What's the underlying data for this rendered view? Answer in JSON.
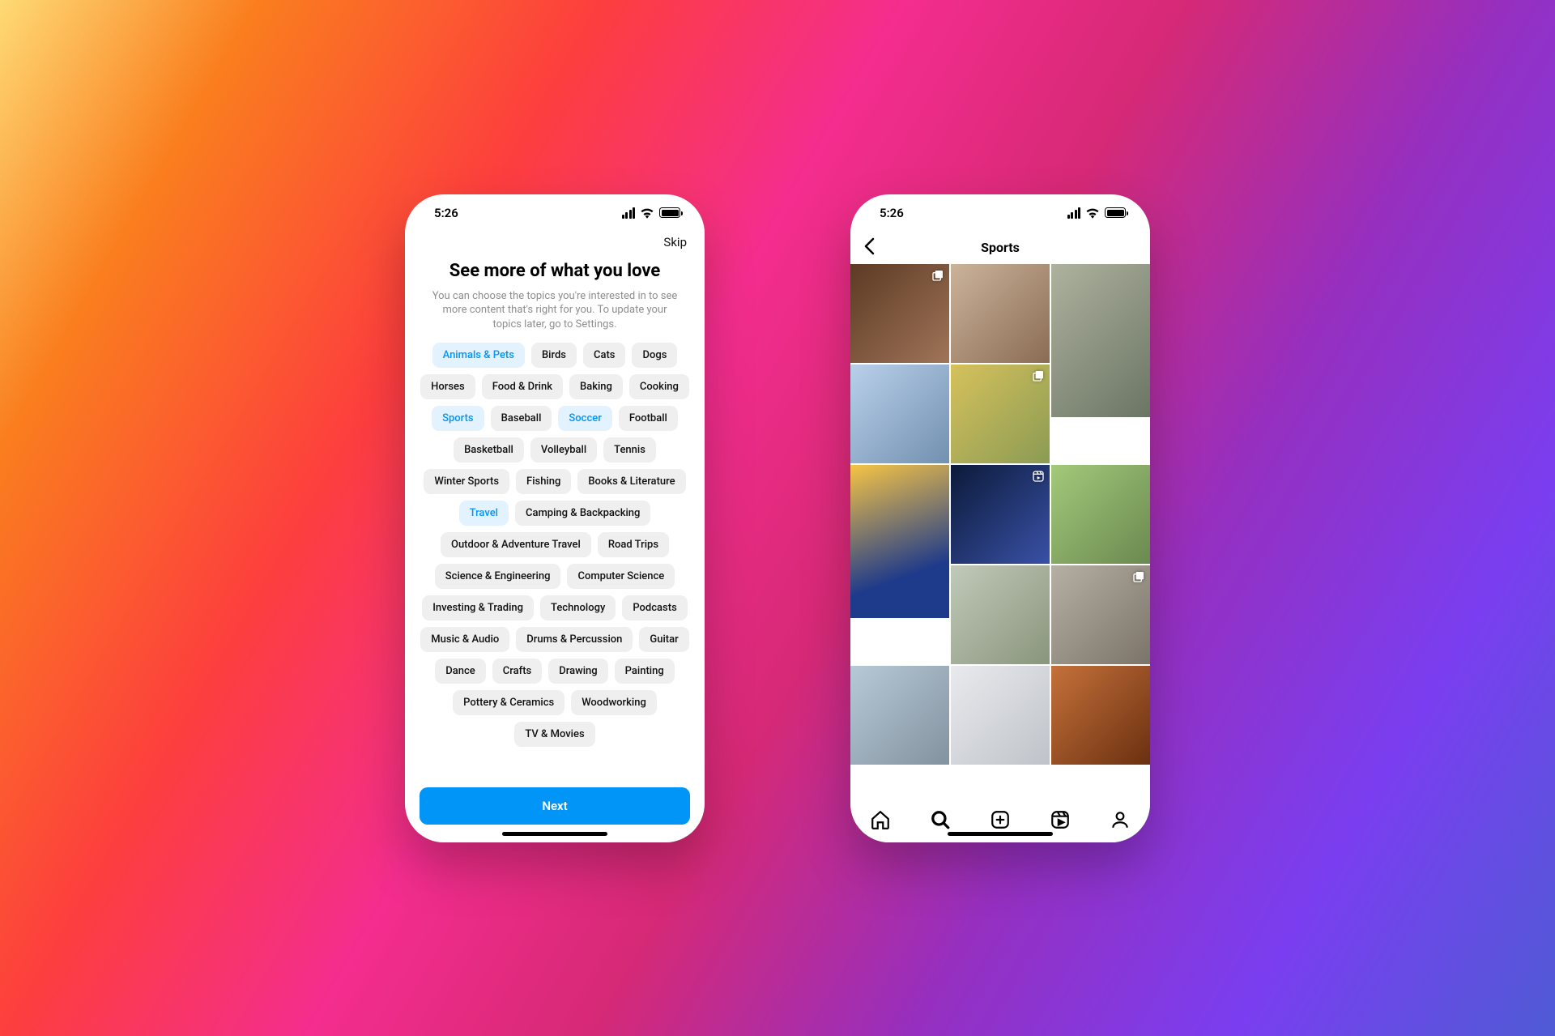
{
  "status": {
    "time": "5:26"
  },
  "phone1": {
    "skip": "Skip",
    "title": "See more of what you love",
    "subtitle": "You can choose the topics you're interested in to see more content that's right for you. To update your topics later, go to Settings.",
    "next": "Next",
    "chips": [
      {
        "label": "Animals & Pets",
        "sel": true
      },
      {
        "label": "Birds",
        "sel": false
      },
      {
        "label": "Cats",
        "sel": false
      },
      {
        "label": "Dogs",
        "sel": false
      },
      {
        "label": "Horses",
        "sel": false
      },
      {
        "label": "Food & Drink",
        "sel": false
      },
      {
        "label": "Baking",
        "sel": false
      },
      {
        "label": "Cooking",
        "sel": false
      },
      {
        "label": "Sports",
        "sel": true
      },
      {
        "label": "Baseball",
        "sel": false
      },
      {
        "label": "Soccer",
        "sel": true
      },
      {
        "label": "Football",
        "sel": false
      },
      {
        "label": "Basketball",
        "sel": false
      },
      {
        "label": "Volleyball",
        "sel": false
      },
      {
        "label": "Tennis",
        "sel": false
      },
      {
        "label": "Winter Sports",
        "sel": false
      },
      {
        "label": "Fishing",
        "sel": false
      },
      {
        "label": "Books & Literature",
        "sel": false
      },
      {
        "label": "Travel",
        "sel": true
      },
      {
        "label": "Camping & Backpacking",
        "sel": false
      },
      {
        "label": "Outdoor & Adventure Travel",
        "sel": false
      },
      {
        "label": "Road Trips",
        "sel": false
      },
      {
        "label": "Science & Engineering",
        "sel": false
      },
      {
        "label": "Computer Science",
        "sel": false
      },
      {
        "label": "Investing & Trading",
        "sel": false
      },
      {
        "label": "Technology",
        "sel": false
      },
      {
        "label": "Podcasts",
        "sel": false
      },
      {
        "label": "Music & Audio",
        "sel": false
      },
      {
        "label": "Drums & Percussion",
        "sel": false
      },
      {
        "label": "Guitar",
        "sel": false
      },
      {
        "label": "Dance",
        "sel": false
      },
      {
        "label": "Crafts",
        "sel": false
      },
      {
        "label": "Drawing",
        "sel": false
      },
      {
        "label": "Painting",
        "sel": false
      },
      {
        "label": "Pottery & Ceramics",
        "sel": false
      },
      {
        "label": "Woodworking",
        "sel": false
      },
      {
        "label": "TV & Movies",
        "sel": false
      }
    ]
  },
  "phone2": {
    "title": "Sports",
    "tabs": [
      {
        "name": "home",
        "active": false
      },
      {
        "name": "search",
        "active": true
      },
      {
        "name": "create",
        "active": false
      },
      {
        "name": "reels",
        "active": false
      },
      {
        "name": "profile",
        "active": false
      }
    ],
    "tiles": [
      {
        "name": "portrait-denim",
        "size": "sm",
        "cls": "t-a",
        "badge": "carousel"
      },
      {
        "name": "skateboard-brick",
        "size": "sm",
        "cls": "t-b",
        "badge": null
      },
      {
        "name": "stretch-building",
        "size": "lg",
        "cls": "t-c",
        "badge": null,
        "tall": true
      },
      {
        "name": "street-skate",
        "size": "sm",
        "cls": "t-d",
        "badge": null
      },
      {
        "name": "grass-yellow",
        "size": "sm",
        "cls": "t-e",
        "badge": "carousel"
      },
      {
        "name": "soccer-juggle",
        "size": "lg",
        "cls": "t-g",
        "badge": null,
        "tall": true
      },
      {
        "name": "trophy-blue",
        "size": "sm",
        "cls": "t-h",
        "badge": "reel"
      },
      {
        "name": "park-green",
        "size": "sm",
        "cls": "t-i",
        "badge": null
      },
      {
        "name": "drive-basketball",
        "size": "sm",
        "cls": "t-j",
        "badge": null
      },
      {
        "name": "leap-trees",
        "size": "sm",
        "cls": "t-k",
        "badge": "carousel"
      },
      {
        "name": "bike-blue",
        "size": "sm",
        "cls": "t-l",
        "badge": null
      },
      {
        "name": "skate-legs",
        "size": "sm",
        "cls": "t-m",
        "badge": null
      },
      {
        "name": "basketball-hand",
        "size": "sm",
        "cls": "t-n",
        "badge": null
      }
    ]
  }
}
